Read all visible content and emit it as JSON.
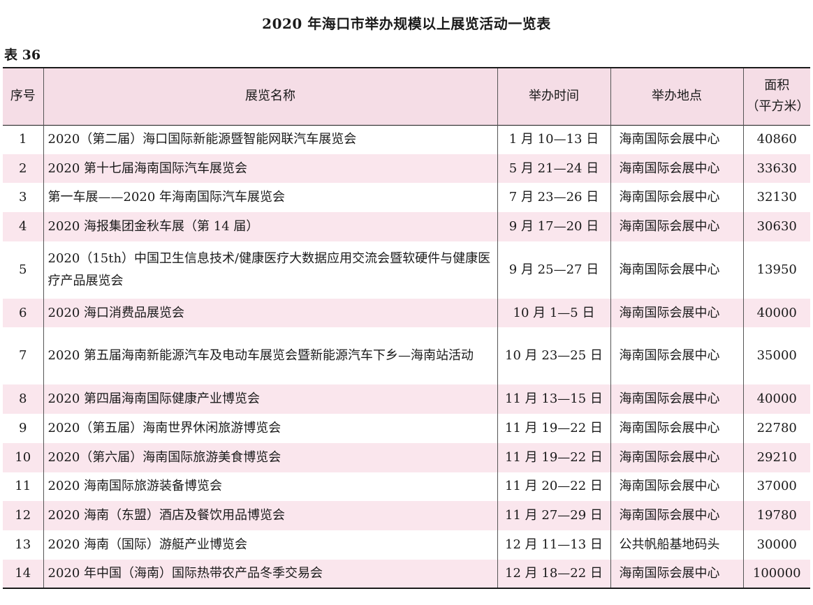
{
  "title": "2020 年海口市举办规模以上展览活动一览表",
  "table_label": "表 36",
  "headers": {
    "no": "序号",
    "name": "展览名称",
    "time": "举办时间",
    "place": "举办地点",
    "area_line1": "面积",
    "area_line2": "（平方米）"
  },
  "rows": [
    {
      "no": "1",
      "name": "2020（第二届）海口国际新能源暨智能网联汽车展览会",
      "time": "1 月 10—13 日",
      "place": "海南国际会展中心",
      "area": "40860"
    },
    {
      "no": "2",
      "name": "2020 第十七届海南国际汽车展览会",
      "time": "5 月 21—24 日",
      "place": "海南国际会展中心",
      "area": "33630"
    },
    {
      "no": "3",
      "name": "第一车展——2020 年海南国际汽车展览会",
      "time": "7 月 23—26 日",
      "place": "海南国际会展中心",
      "area": "32130"
    },
    {
      "no": "4",
      "name": "2020 海报集团金秋车展（第 14 届）",
      "time": "9 月 17—20 日",
      "place": "海南国际会展中心",
      "area": "30630"
    },
    {
      "no": "5",
      "name": "2020（15th）中国卫生信息技术/健康医疗大数据应用交流会暨软硬件与健康医疗产品展览会",
      "time": "9 月 25—27 日",
      "place": "海南国际会展中心",
      "area": "13950"
    },
    {
      "no": "6",
      "name": "2020 海口消费品展览会",
      "time": "10 月 1—5 日",
      "place": "海南国际会展中心",
      "area": "40000"
    },
    {
      "no": "7",
      "name": "2020 第五届海南新能源汽车及电动车展览会暨新能源汽车下乡—海南站活动",
      "time": "10 月 23—25 日",
      "place": "海南国际会展中心",
      "area": "35000"
    },
    {
      "no": "8",
      "name": "2020 第四届海南国际健康产业博览会",
      "time": "11 月 13—15 日",
      "place": "海南国际会展中心",
      "area": "40000"
    },
    {
      "no": "9",
      "name": "2020（第五届）海南世界休闲旅游博览会",
      "time": "11 月 19—22 日",
      "place": "海南国际会展中心",
      "area": "22780"
    },
    {
      "no": "10",
      "name": "2020（第六届）海南国际旅游美食博览会",
      "time": "11 月 19—22 日",
      "place": "海南国际会展中心",
      "area": "29210"
    },
    {
      "no": "11",
      "name": "2020 海南国际旅游装备博览会",
      "time": "11 月 20—22 日",
      "place": "海南国际会展中心",
      "area": "37000"
    },
    {
      "no": "12",
      "name": "2020 海南（东盟）酒店及餐饮用品博览会",
      "time": "11 月 27—29 日",
      "place": "海南国际会展中心",
      "area": "19780"
    },
    {
      "no": "13",
      "name": "2020 海南（国际）游艇产业博览会",
      "time": "12 月 11—13 日",
      "place": "公共帆船基地码头",
      "area": "30000"
    },
    {
      "no": "14",
      "name": "2020 年中国（海南）国际热带农产品冬季交易会",
      "time": "12 月 18—22 日",
      "place": "海南国际会展中心",
      "area": "100000"
    }
  ]
}
